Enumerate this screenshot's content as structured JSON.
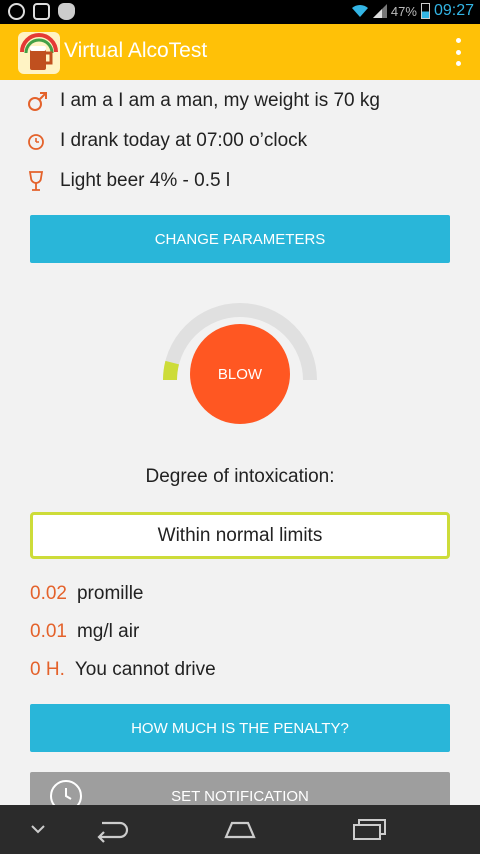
{
  "status_bar": {
    "battery": "47%",
    "time": "09:27",
    "icons": [
      "sync-icon",
      "alarm-icon",
      "cat-icon",
      "wifi-icon",
      "signal-icon",
      "battery-icon"
    ]
  },
  "app_bar": {
    "title": "Virtual AlcoTest",
    "logo_icon": "beer-mug-icon",
    "overflow_icon": "overflow-menu-icon"
  },
  "parameters": {
    "person": "I am a I am a man, my weight is 70 kg",
    "time": "I drank today at 07:00 o’clock",
    "drink": "Light beer 4% - 0.5 l",
    "change_button": "CHANGE PARAMETERS"
  },
  "gauge": {
    "level": 0.08,
    "blow_label": "BLOW",
    "fill_color": "#cddc39",
    "track_color": "#e0e0e0"
  },
  "result": {
    "label": "Degree of intoxication:",
    "value": "Within normal limits"
  },
  "readings": [
    {
      "value": "0.02",
      "unit": "promille"
    },
    {
      "value": "0.01",
      "unit": "mg/l air"
    },
    {
      "value": "0 H.",
      "unit": "You cannot drive"
    }
  ],
  "penalty_button": "HOW MUCH IS THE PENALTY?",
  "notification_button": "SET NOTIFICATION",
  "colors": {
    "accent": "#ffc107",
    "button": "#29b6d9",
    "blow": "#ff5722",
    "value": "#e4622b",
    "result_border": "#cddc39"
  }
}
